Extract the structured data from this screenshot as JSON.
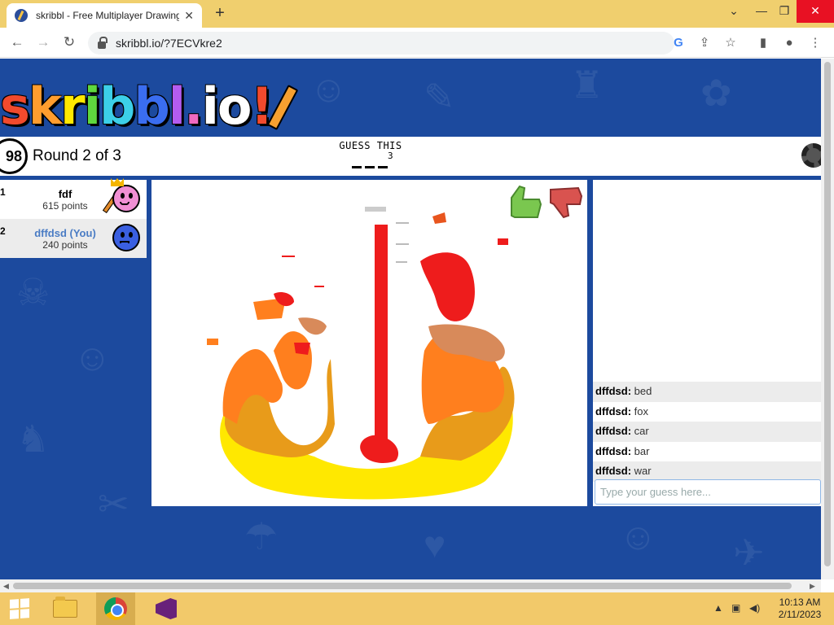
{
  "browser": {
    "tab_title": "skribbl - Free Multiplayer Drawing",
    "tab_close": "✕",
    "new_tab": "+",
    "url": "skribbl.io/?7ECVkre2",
    "window_minimize": "⌄",
    "window_min": "—",
    "window_restore": "❐",
    "window_close": "✕"
  },
  "logo": {
    "text": "skribbl.io!"
  },
  "game": {
    "timer": "98",
    "round_text": "Round 2 of 3",
    "guess_label": "GUESS THIS",
    "word_length": "3"
  },
  "players": [
    {
      "rank": "1",
      "name": "fdf",
      "points": "615 points",
      "avatar_color": "#f08fd4",
      "is_drawing": true
    },
    {
      "rank": "2",
      "name": "dffdsd (You)",
      "points": "240 points",
      "avatar_color": "#3a5fe0",
      "is_drawing": false
    }
  ],
  "chat": {
    "messages": [
      {
        "user": "dffdsd:",
        "text": "bed"
      },
      {
        "user": "dffdsd:",
        "text": "fox"
      },
      {
        "user": "dffdsd:",
        "text": "car"
      },
      {
        "user": "dffdsd:",
        "text": "bar"
      },
      {
        "user": "dffdsd:",
        "text": "war"
      }
    ],
    "input_placeholder": "Type your guess here..."
  },
  "colors": {
    "page_bg": "#1c4a9e",
    "like": "#7ac74f",
    "dislike": "#d9534f",
    "flame_red": "#ee1c1c",
    "flame_orange": "#ff7f1e",
    "flame_amber": "#e89b1a",
    "flame_yellow": "#ffe800",
    "flame_tan": "#d88a5a"
  },
  "taskbar": {
    "time": "10:13 AM",
    "date": "2/11/2023"
  }
}
